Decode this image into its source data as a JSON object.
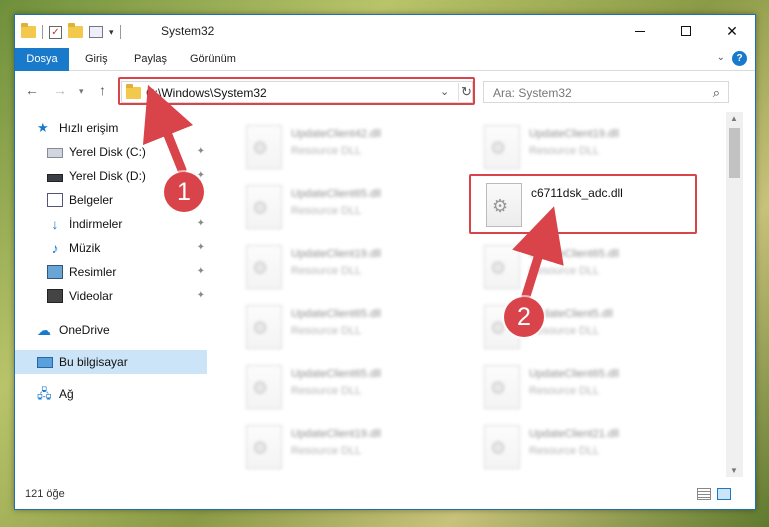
{
  "window": {
    "title": "System32",
    "quick_access_dropdown": "▾"
  },
  "ribbon": {
    "tabs": [
      "Dosya",
      "Giriş",
      "Paylaş",
      "Görünüm"
    ],
    "expand_glyph": "⌄",
    "help_glyph": "?"
  },
  "nav": {
    "address": "C:\\Windows\\System32",
    "search_placeholder": "Ara: System32"
  },
  "sidebar": {
    "items": [
      {
        "label": "Hızlı erişim",
        "icon": "star-icon",
        "pinned": false
      },
      {
        "label": "Yerel Disk (C:)",
        "icon": "drive-icon",
        "pinned": true
      },
      {
        "label": "Yerel Disk (D:)",
        "icon": "drive-icon",
        "pinned": true
      },
      {
        "label": "Belgeler",
        "icon": "documents-icon",
        "pinned": true
      },
      {
        "label": "İndirmeler",
        "icon": "download-icon",
        "pinned": true
      },
      {
        "label": "Müzik",
        "icon": "music-icon",
        "pinned": true
      },
      {
        "label": "Resimler",
        "icon": "pictures-icon",
        "pinned": true
      },
      {
        "label": "Videolar",
        "icon": "video-icon",
        "pinned": true
      },
      {
        "label": "OneDrive",
        "icon": "onedrive-icon",
        "pinned": false
      },
      {
        "label": "Bu bilgisayar",
        "icon": "computer-icon",
        "pinned": false,
        "selected": true
      },
      {
        "label": "Ağ",
        "icon": "network-icon",
        "pinned": false
      }
    ]
  },
  "files": {
    "left_column": [
      {
        "name": "UpdateClient42.dll",
        "type": "Resource DLL"
      },
      {
        "name": "UpdateClient65.dll",
        "type": "Resource DLL"
      },
      {
        "name": "UpdateClient19.dll",
        "type": "Resource DLL"
      },
      {
        "name": "UpdateClient65.dll",
        "type": "Resource DLL"
      },
      {
        "name": "UpdateClient65.dll",
        "type": "Resource DLL"
      },
      {
        "name": "UpdateClient19.dll",
        "type": "Resource DLL"
      }
    ],
    "right_column": [
      {
        "name": "UpdateClient19.dll",
        "type": "Resource DLL"
      },
      {
        "name": "c6711dsk_adc.dll",
        "type": ""
      },
      {
        "name": "UpdateClient65.dll",
        "type": "Resource DLL"
      },
      {
        "name": "UpdateClient5.dll",
        "type": "Resource DLL"
      },
      {
        "name": "UpdateClient65.dll",
        "type": "Resource DLL"
      },
      {
        "name": "UpdateClient21.dll",
        "type": "Resource DLL"
      }
    ]
  },
  "status": {
    "item_count": "121 öğe"
  },
  "callouts": {
    "one": "1",
    "two": "2"
  },
  "colors": {
    "accent": "#1979ca",
    "highlight": "#d9434a",
    "selection": "#cce4f7"
  }
}
